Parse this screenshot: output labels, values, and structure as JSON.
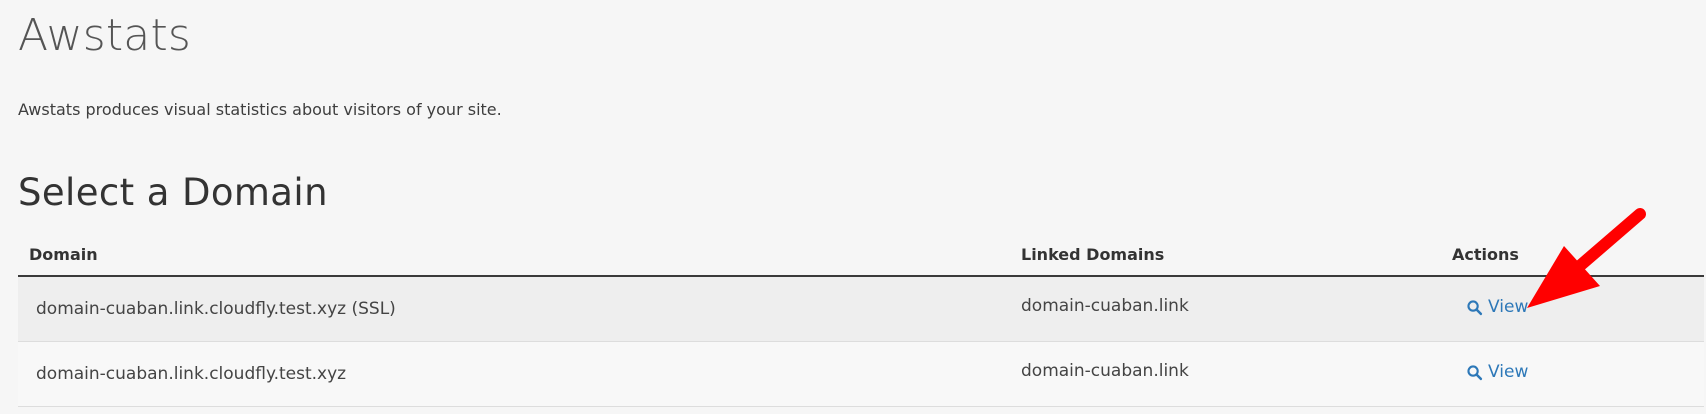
{
  "page": {
    "title": "Awstats",
    "description": "Awstats produces visual statistics about visitors of your site."
  },
  "section": {
    "title": "Select a Domain"
  },
  "table": {
    "headers": {
      "domain": "Domain",
      "linked_domains": "Linked Domains",
      "actions": "Actions"
    },
    "rows": [
      {
        "domain": "domain-cuaban.link.cloudfly.test.xyz (SSL)",
        "linked_domains": "domain-cuaban.link",
        "action_label": "View"
      },
      {
        "domain": "domain-cuaban.link.cloudfly.test.xyz",
        "linked_domains": "domain-cuaban.link",
        "action_label": "View"
      }
    ]
  },
  "annotation": {
    "icon": "red-arrow-icon",
    "color": "#ff0000"
  },
  "colors": {
    "background": "#f6f6f6",
    "link": "#2d78b8",
    "stripe": "#eeeeee"
  }
}
